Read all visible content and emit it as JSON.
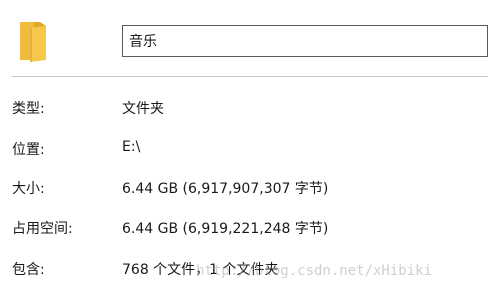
{
  "folder": {
    "icon": "folder-icon",
    "name": "音乐"
  },
  "properties": [
    {
      "label": "类型:",
      "value": "文件夹"
    },
    {
      "label": "位置:",
      "value": "E:\\"
    },
    {
      "label": "大小:",
      "value": "6.44 GB (6,917,907,307 字节)"
    },
    {
      "label": "占用空间:",
      "value": "6.44 GB (6,919,221,248 字节)"
    },
    {
      "label": "包含:",
      "value": "768 个文件，1 个文件夹"
    }
  ],
  "watermark": "http://blog.csdn.net/xHibiki",
  "colors": {
    "folder_front": "#F5C84C",
    "folder_back": "#E2A82A",
    "border": "#5a5a5a",
    "divider": "#c8c8c8"
  }
}
